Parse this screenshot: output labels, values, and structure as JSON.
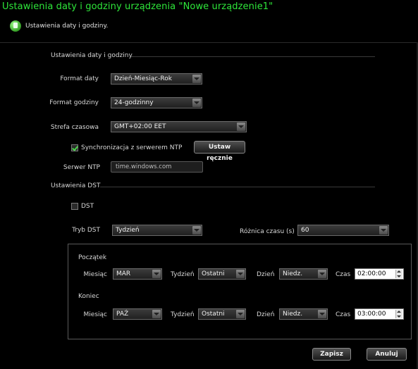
{
  "window": {
    "title": "Ustawienia daty i godziny urządzenia \"Nowe urządzenie1\""
  },
  "header": {
    "subtitle": "Ustawienia daty i godziny.",
    "icon": "info-icon"
  },
  "datetime_section": {
    "title": "Ustawienia daty i godziny.",
    "date_format": {
      "label": "Format daty",
      "value": "Dzień-Miesiąc-Rok"
    },
    "time_format": {
      "label": "Format godziny",
      "value": "24-godzinny"
    },
    "timezone": {
      "label": "Strefa czasowa",
      "value": "GMT+02:00 EET"
    },
    "ntp_sync": {
      "label": "Synchronizacja z serwerem NTP",
      "checked": true
    },
    "manual_set_button": "Ustaw ręcznie",
    "ntp_server": {
      "label": "Serwer NTP",
      "value": "time.windows.com"
    }
  },
  "dst_section": {
    "title": "Ustawienia DST",
    "dst_checkbox": {
      "label": "DST",
      "checked": false
    },
    "mode": {
      "label": "Tryb DST",
      "value": "Tydzień"
    },
    "time_diff": {
      "label": "Różnica czasu (s)",
      "value": "60"
    },
    "start": {
      "title": "Początek",
      "month_label": "Miesiąc",
      "month": "MAR",
      "week_label": "Tydzień",
      "week": "Ostatni",
      "day_label": "Dzień",
      "day": "Niedz.",
      "time_label": "Czas",
      "time": "02:00:00"
    },
    "end": {
      "title": "Koniec",
      "month_label": "Miesiąc",
      "month": "PAŹ",
      "week_label": "Tydzień",
      "week": "Ostatni",
      "day_label": "Dzień",
      "day": "Niedz.",
      "time_label": "Czas",
      "time": "03:00:00"
    }
  },
  "footer": {
    "save": "Zapisz",
    "cancel": "Anuluj"
  },
  "colors": {
    "title": "#2ee63a",
    "background": "#000000",
    "checkmark": "#4bd44b"
  }
}
